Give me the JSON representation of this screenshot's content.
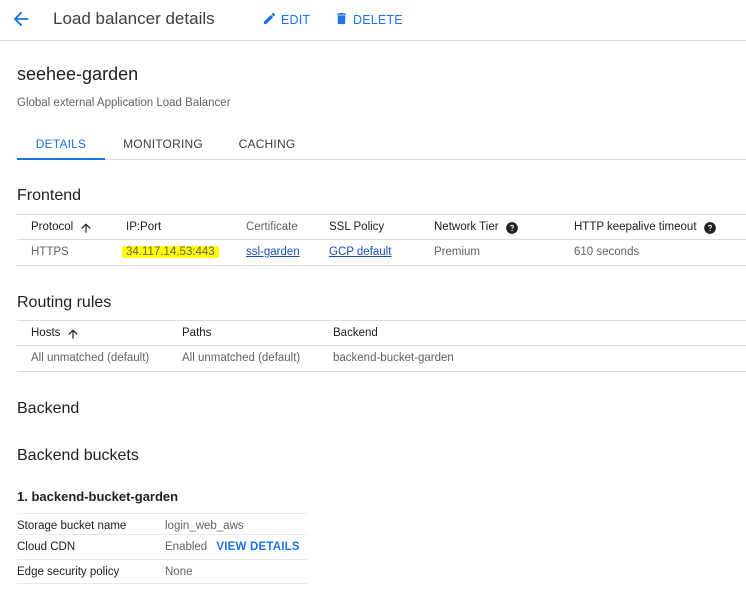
{
  "header": {
    "title": "Load balancer details",
    "edit_label": "EDIT",
    "delete_label": "DELETE"
  },
  "lb": {
    "name": "seehee-garden",
    "type": "Global external Application Load Balancer"
  },
  "tabs": [
    {
      "label": "DETAILS",
      "active": true
    },
    {
      "label": "MONITORING",
      "active": false
    },
    {
      "label": "CACHING",
      "active": false
    }
  ],
  "frontend": {
    "title": "Frontend",
    "columns": [
      "Protocol",
      "IP:Port",
      "Certificate",
      "SSL Policy",
      "Network Tier",
      "HTTP keepalive timeout"
    ],
    "rows": [
      {
        "protocol": "HTTPS",
        "ip_port": "34.117.14.53:443",
        "certificate": "ssl-garden",
        "ssl_policy": "GCP default",
        "network_tier": "Premium",
        "keepalive": "610 seconds"
      }
    ],
    "highlight_color": "#ffff00"
  },
  "routing": {
    "title": "Routing rules",
    "columns": [
      "Hosts",
      "Paths",
      "Backend"
    ],
    "rows": [
      {
        "hosts": "All unmatched (default)",
        "paths": "All unmatched (default)",
        "backend": "backend-bucket-garden"
      }
    ]
  },
  "backend": {
    "title": "Backend",
    "buckets_title": "Backend buckets",
    "bucket_heading": "1. backend-bucket-garden",
    "details": [
      {
        "key": "Storage bucket name",
        "value": "login_web_aws"
      },
      {
        "key": "Cloud CDN",
        "value": "Enabled",
        "action": "VIEW DETAILS"
      },
      {
        "key": "Edge security policy",
        "value": "None"
      }
    ]
  },
  "icons": {
    "back": "arrow-back-icon",
    "edit": "pencil-icon",
    "delete": "trash-icon",
    "sort": "arrow-up-icon",
    "help": "help-circle-icon"
  },
  "colors": {
    "accent": "#1a73e8",
    "link": "#1a4fb8",
    "text": "#202124",
    "muted": "#5f6368",
    "divider": "#dadce0"
  }
}
